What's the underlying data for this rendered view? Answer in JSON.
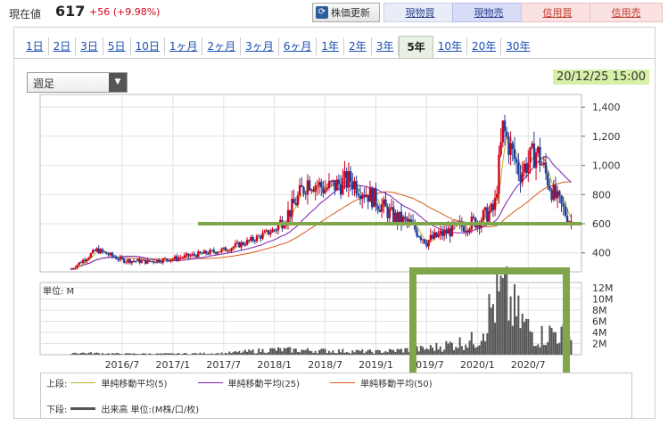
{
  "quote": {
    "price_label": "現在値",
    "price": "617",
    "change": "+56 (+9.98%)"
  },
  "toolbar": {
    "refresh_label": "株価更新",
    "refresh_icon": "refresh-icon",
    "buttons": [
      "現物買",
      "現物売",
      "信用買",
      "信用売"
    ]
  },
  "period_tabs": {
    "items": [
      "1日",
      "2日",
      "3日",
      "5日",
      "10日",
      "1ヶ月",
      "2ヶ月",
      "3ヶ月",
      "6ヶ月",
      "1年",
      "2年",
      "3年",
      "5年",
      "10年",
      "20年",
      "30年"
    ],
    "active": "5年"
  },
  "interval_select": {
    "value": "週足"
  },
  "chart_time": {
    "date": "20/12/25",
    "time": "15:00"
  },
  "legend": {
    "upper_label": "上段:",
    "lower_label": "下段:",
    "ma5": "単純移動平均(5)",
    "ma25": "単純移動平均(25)",
    "ma50": "単純移動平均(50)",
    "volume": "出来高 単位:(M株/口/枚)"
  },
  "colors": {
    "candle_up": "#d0021b",
    "candle_down": "#1f3f99",
    "ma5": "#b5b52a",
    "ma25": "#7a1fb0",
    "ma50": "#d65a1a",
    "highlight": "#7fa64a",
    "volume": "#555555"
  },
  "chart_data": [
    {
      "type": "candlestick",
      "price_axis": {
        "ticks": [
          400,
          600,
          800,
          1000,
          1200,
          1400
        ],
        "range": [
          270,
          1450
        ]
      },
      "x_ticks": [
        "2016/7",
        "2017/1",
        "2017/7",
        "2018/1",
        "2018/7",
        "2019/1",
        "2019/7",
        "2020/1",
        "2020/7"
      ],
      "annotation_level": 600,
      "approx_close_path": [
        [
          "2016/1",
          290
        ],
        [
          "2016/4",
          420
        ],
        [
          "2016/7",
          350
        ],
        [
          "2016/10",
          340
        ],
        [
          "2017/1",
          360
        ],
        [
          "2017/4",
          390
        ],
        [
          "2017/7",
          420
        ],
        [
          "2017/10",
          480
        ],
        [
          "2018/1",
          560
        ],
        [
          "2018/3",
          700
        ],
        [
          "2018/5",
          900
        ],
        [
          "2018/7",
          840
        ],
        [
          "2018/10",
          900
        ],
        [
          "2019/1",
          760
        ],
        [
          "2019/3",
          650
        ],
        [
          "2019/5",
          600
        ],
        [
          "2019/7",
          480
        ],
        [
          "2019/10",
          560
        ],
        [
          "2020/1",
          620
        ],
        [
          "2020/3",
          700
        ],
        [
          "2020/4",
          1250
        ],
        [
          "2020/6",
          950
        ],
        [
          "2020/8",
          1100
        ],
        [
          "2020/10",
          800
        ],
        [
          "2020/12",
          617
        ]
      ]
    },
    {
      "type": "bar",
      "title": "単位: M",
      "y_ticks": [
        "2M",
        "4M",
        "6M",
        "8M",
        "10M",
        "12M"
      ],
      "range": [
        0,
        12
      ],
      "approx_volume_M": [
        [
          "2016/1",
          0.4
        ],
        [
          "2016/7",
          0.2
        ],
        [
          "2017/1",
          0.2
        ],
        [
          "2017/7",
          0.3
        ],
        [
          "2018/1",
          1.0
        ],
        [
          "2018/7",
          0.8
        ],
        [
          "2019/1",
          0.6
        ],
        [
          "2019/7",
          1.2
        ],
        [
          "2020/1",
          3.0
        ],
        [
          "2020/3",
          10.5
        ],
        [
          "2020/4",
          12.0
        ],
        [
          "2020/6",
          7.0
        ],
        [
          "2020/8",
          3.5
        ],
        [
          "2020/10",
          4.5
        ],
        [
          "2020/12",
          3.5
        ]
      ]
    }
  ]
}
